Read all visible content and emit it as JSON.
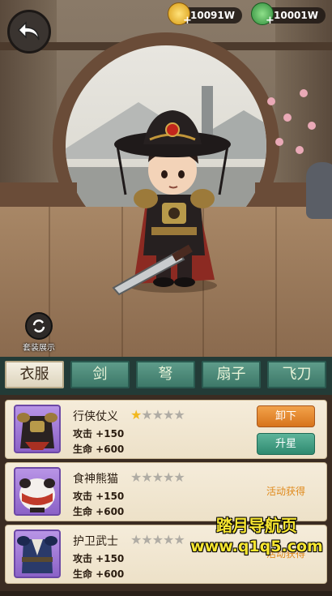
{
  "header": {
    "back_icon": "back-arrow-icon",
    "gold": {
      "icon": "gold-coin-icon",
      "value": "10091W",
      "plus": "+",
      "color": "#f0c020"
    },
    "jade": {
      "icon": "green-leaf-icon",
      "value": "10001W",
      "plus": "+",
      "color": "#3fae4a"
    }
  },
  "outfit_button": {
    "icon": "refresh-icon",
    "label": "套装展示"
  },
  "tabs": [
    {
      "label": "衣服",
      "active": true
    },
    {
      "label": "剑",
      "active": false
    },
    {
      "label": "弩",
      "active": false
    },
    {
      "label": "扇子",
      "active": false
    },
    {
      "label": "飞刀",
      "active": false
    }
  ],
  "items": [
    {
      "name": "行侠仗义",
      "stars_filled": 1,
      "stars_total": 5,
      "attack": "攻击 +150",
      "hp": "生命 +600",
      "action1": "卸下",
      "action2": "升星",
      "thumb_icon": "black-armor-icon"
    },
    {
      "name": "食神熊猫",
      "stars_filled": 0,
      "stars_total": 5,
      "attack": "攻击 +150",
      "hp": "生命 +600",
      "status": "活动获得",
      "thumb_icon": "panda-costume-icon"
    },
    {
      "name": "护卫武士",
      "stars_filled": 0,
      "stars_total": 5,
      "attack": "攻击 +150",
      "hp": "生命 +600",
      "status": "活动获得",
      "thumb_icon": "guard-armor-icon"
    }
  ],
  "watermark": {
    "line1": "踏月导航页",
    "line2": "www.q1q5.com"
  },
  "colors": {
    "tab_active_bg": "#f4efe2",
    "tab_bg": "#4f8c7a",
    "star_gold": "#f2b81e",
    "star_gray": "#b0aca4"
  }
}
